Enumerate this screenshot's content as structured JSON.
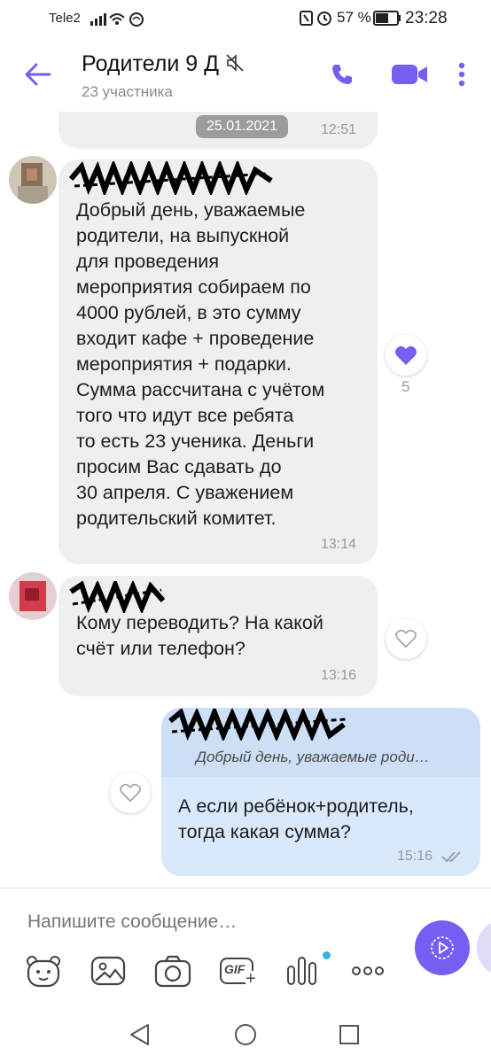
{
  "status_bar": {
    "carrier": "Tele2",
    "battery_percent": "57 %",
    "time": "23:28"
  },
  "header": {
    "title": "Родители 9 Д",
    "subtitle": "23 участника"
  },
  "messages": [
    {
      "date_chip": "25.01.2021",
      "time": "12:51"
    },
    {
      "text": "Добрый день, уважаемые\nродители, на выпускной\nдля проведения\nмероприятия собираем по\n4000 рублей, в это сумму\nвходит кафе + проведение\nмероприятия + подарки.\nСумма рассчитана с учётом\nтого что идут все ребята\nто есть 23 ученика. Деньги\nпросим Вас сдавать до\n30 апреля. С уважением\nродительский комитет.",
      "time": "13:14",
      "like_count": "5"
    },
    {
      "text": "Кому переводить? На какой\nсчёт или телефон?",
      "time": "13:16"
    },
    {
      "quote": "Добрый день, уважаемые роди…",
      "text": "А если ребёнок+родитель,\nтогда какая сумма?",
      "time": "15:16"
    }
  ],
  "composer": {
    "placeholder": "Напишите сообщение…",
    "gif_label": "GIF"
  },
  "colors": {
    "accent": "#7360f2",
    "bubble_in": "#efefef",
    "bubble_out": "#d9e8fb"
  }
}
